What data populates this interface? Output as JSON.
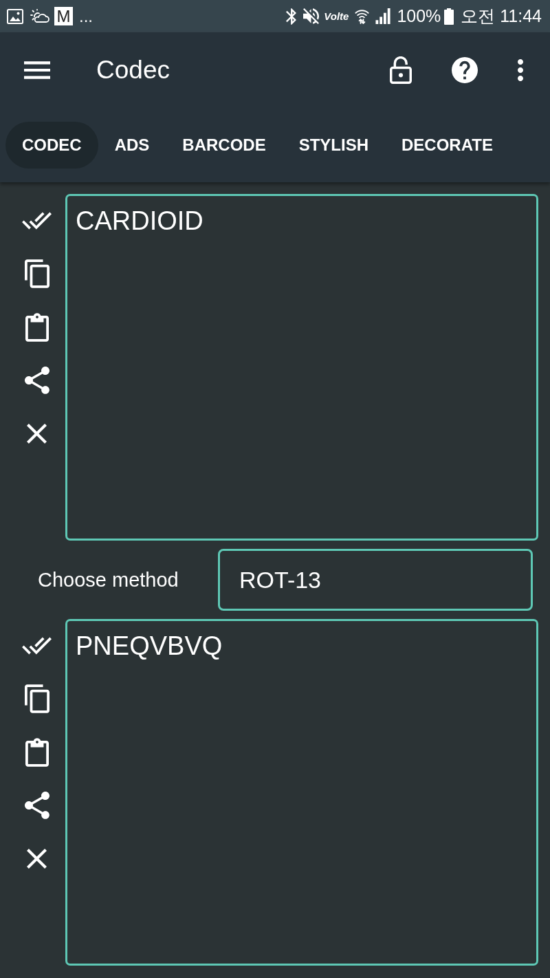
{
  "status_bar": {
    "notification_badge": "M",
    "more": "...",
    "network_label": "Volte",
    "battery": "100%",
    "time": "오전 11:44"
  },
  "app_bar": {
    "title": "Codec"
  },
  "tabs": [
    {
      "label": "CODEC",
      "selected": true
    },
    {
      "label": "ADS",
      "selected": false
    },
    {
      "label": "BARCODE",
      "selected": false
    },
    {
      "label": "STYLISH",
      "selected": false
    },
    {
      "label": "DECORATE",
      "selected": false
    }
  ],
  "input": {
    "text": "CARDIOID"
  },
  "method": {
    "label": "Choose method",
    "value": "ROT-13"
  },
  "output": {
    "text": "PNEQVBVQ"
  }
}
